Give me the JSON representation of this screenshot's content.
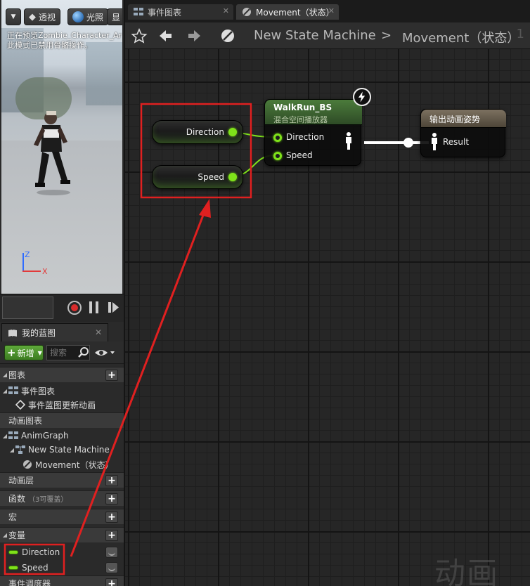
{
  "viewport": {
    "btn_perspective": "透视",
    "btn_lighting": "光照",
    "btn_show": "显",
    "preview_line1": "正在预览Zombie_Character_Ar",
    "preview_line2": "此模式已禁用骨骼操作。",
    "axis_z": "Z",
    "axis_x": "X"
  },
  "blueprint": {
    "tab_label": "我的蓝图",
    "tab_close": "✕",
    "new_label": "新增",
    "search_placeholder": "搜索",
    "sections": {
      "graphs": "图表",
      "event_graph": "事件图表",
      "event_update": "事件蓝图更新动画",
      "anim_graphs": "动画图表",
      "anim_graph": "AnimGraph",
      "state_machine": "New State Machine",
      "movement": "Movement（状态）",
      "anim_layers": "动画层",
      "functions": "函数",
      "functions_note": "（3可覆盖）",
      "macros": "宏",
      "variables": "变量",
      "event_dispatchers": "事件调度器"
    },
    "variables": [
      {
        "name": "Direction"
      },
      {
        "name": "Speed"
      }
    ]
  },
  "graph": {
    "tab1": "事件图表",
    "tab2": "Movement（状态）",
    "tab_close": "✕",
    "crumb1": "New State Machine",
    "crumb_sep": ">",
    "crumb2": "Movement（状态）",
    "crumb_overflow": "1",
    "var_direction": "Direction",
    "var_speed": "Speed",
    "blendspace_title": "WalkRun_BS",
    "blendspace_subtitle": "混合空间播放器",
    "bs_pin_direction": "Direction",
    "bs_pin_speed": "Speed",
    "output_title": "输出动画姿势",
    "output_pin": "Result",
    "watermark": "动画"
  },
  "colors": {
    "accent_green": "#7fe21a",
    "annotation_red": "#e02020",
    "new_button": "#4f9a2e"
  }
}
